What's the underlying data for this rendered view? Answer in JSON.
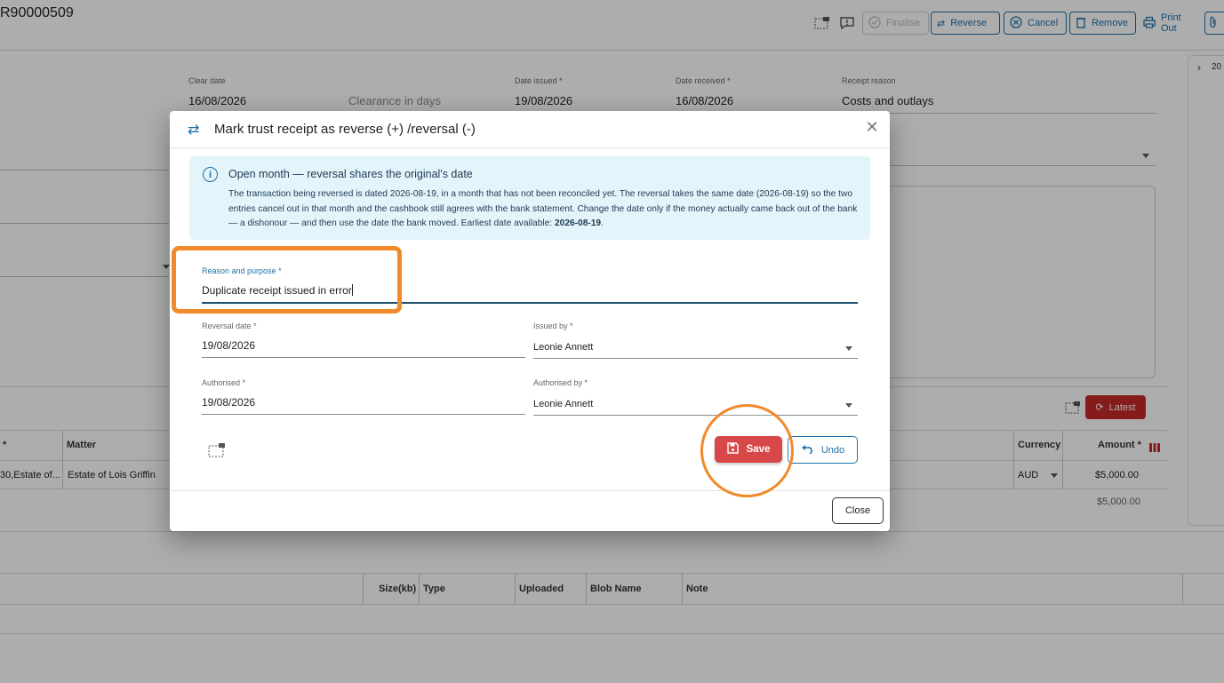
{
  "record": {
    "title": "R90000509"
  },
  "toolbar": {
    "finalise_label": "Finalise",
    "reverse_label": "Reverse",
    "cancel_label": "Cancel",
    "remove_label": "Remove",
    "print_label": "Print Out"
  },
  "form": {
    "clear_date_label": "Clear date",
    "clear_date_value": "16/08/2026",
    "clearance_placeholder": "Clearance in days",
    "date_issued_label": "Date issued *",
    "date_issued_value": "19/08/2026",
    "date_received_label": "Date received *",
    "date_received_value": "16/08/2026",
    "receipt_reason_label": "Receipt reason",
    "receipt_reason_value": "Costs and outlays"
  },
  "table": {
    "headers": {
      "star": "*",
      "matter": "Matter",
      "currency": "Currency",
      "amount": "Amount *"
    },
    "row": {
      "client": "30,Estate of...",
      "matter": "Estate of Lois Griffin",
      "currency": "AUD",
      "amount": "$5,000.00"
    },
    "total": "$5,000.00",
    "latest_label": "Latest"
  },
  "attachments": {
    "headers": {
      "size": "Size(kb)",
      "type": "Type",
      "uploaded": "Uploaded",
      "blob": "Blob Name",
      "note": "Note"
    }
  },
  "side_panel": {
    "text": "20"
  },
  "dialog": {
    "title": "Mark trust receipt as reverse (+) /reversal (-)",
    "info_title": "Open month — reversal shares the original's date",
    "info_body": "The transaction being reversed is dated 2026-08-19, in a month that has not been reconciled yet. The reversal takes the same date (2026-08-19) so the two entries cancel out in that month and the cashbook still agrees with the bank statement. Change the date only if the money actually came back out of the bank — a dishonour — and then use the date the bank moved. Earliest date available: ",
    "info_earliest": "2026-08-19",
    "info_end": ".",
    "reason_label": "Reason and purpose *",
    "reason_value": "Duplicate receipt issued in error",
    "reversal_date_label": "Reversal date *",
    "reversal_date_value": "19/08/2026",
    "issued_by_label": "Issued by *",
    "issued_by_value": "Leonie Annett",
    "authorised_label": "Authorised *",
    "authorised_value": "19/08/2026",
    "authorised_by_label": "Authorised by *",
    "authorised_by_value": "Leonie Annett",
    "save_label": "Save",
    "undo_label": "Undo",
    "close_label": "Close"
  }
}
